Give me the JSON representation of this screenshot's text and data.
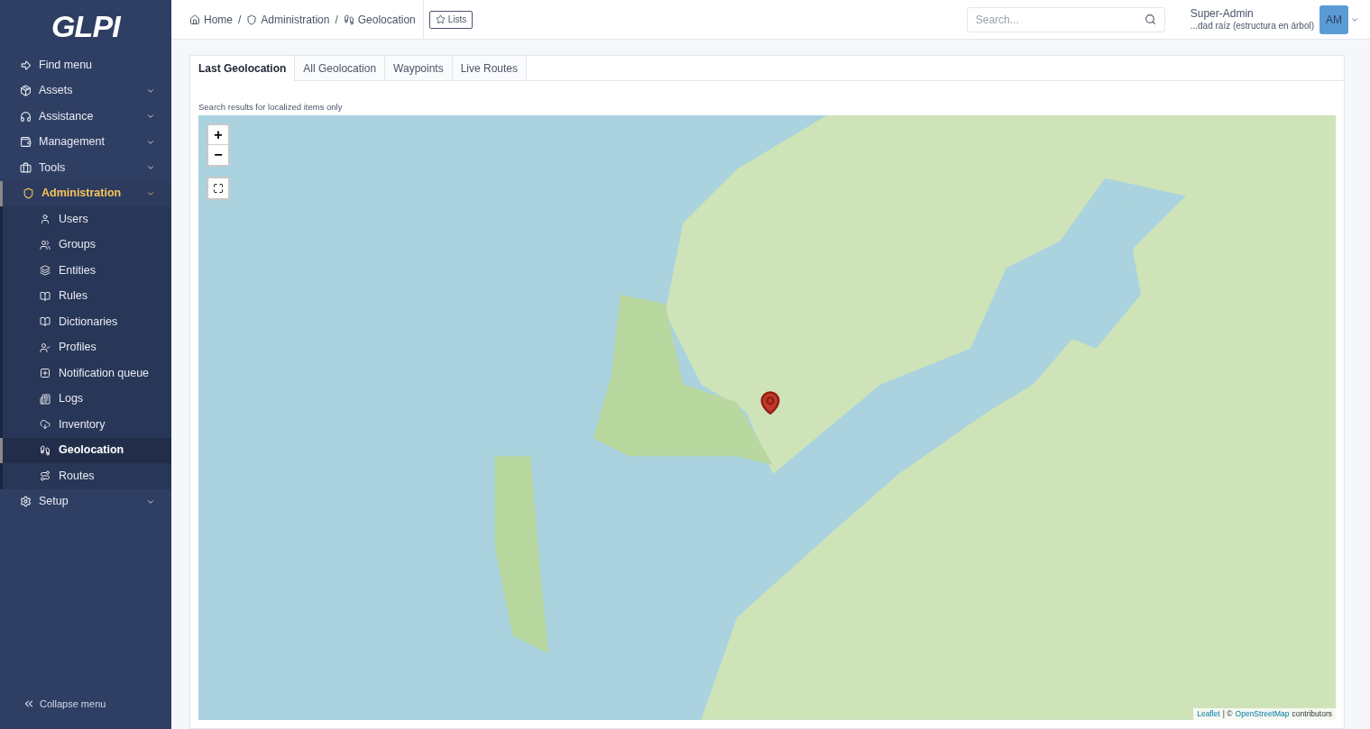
{
  "sidebar": {
    "logo": "GLPI",
    "items": [
      {
        "label": "Find menu",
        "kind": "link",
        "selected": false
      },
      {
        "label": "Assets",
        "kind": "group",
        "selected": false
      },
      {
        "label": "Assistance",
        "kind": "group",
        "selected": false
      },
      {
        "label": "Management",
        "kind": "group",
        "selected": false
      },
      {
        "label": "Tools",
        "kind": "group",
        "selected": false
      },
      {
        "label": "Administration",
        "kind": "group",
        "selected": true,
        "expanded": true,
        "children": [
          {
            "label": "Users",
            "selected": false
          },
          {
            "label": "Groups",
            "selected": false
          },
          {
            "label": "Entities",
            "selected": false
          },
          {
            "label": "Rules",
            "selected": false
          },
          {
            "label": "Dictionaries",
            "selected": false
          },
          {
            "label": "Profiles",
            "selected": false
          },
          {
            "label": "Notification queue",
            "selected": false
          },
          {
            "label": "Logs",
            "selected": false
          },
          {
            "label": "Inventory",
            "selected": false
          },
          {
            "label": "Geolocation",
            "selected": true
          },
          {
            "label": "Routes",
            "selected": false
          }
        ]
      },
      {
        "label": "Setup",
        "kind": "group",
        "selected": false
      }
    ],
    "collapse": "Collapse menu"
  },
  "breadcrumb": [
    "Home",
    "Administration",
    "Geolocation"
  ],
  "breadcrumb_separator": "/",
  "lists_button": "Lists",
  "search": {
    "placeholder": "Search..."
  },
  "user": {
    "name": "Super-Admin",
    "entity": "...dad raíz (estructura en árbol)",
    "initials": "AM"
  },
  "tabs": [
    {
      "label": "Last Geolocation",
      "selected": true
    },
    {
      "label": "All Geolocation",
      "selected": false
    },
    {
      "label": "Waypoints",
      "selected": false
    },
    {
      "label": "Live Routes",
      "selected": false
    }
  ],
  "caption": "Search results for localized items only",
  "map": {
    "zoom_in": "+",
    "zoom_out": "−",
    "attribution": {
      "leaflet": "Leaflet",
      "separator": "| ©",
      "osm": "OpenStreetMap",
      "rest": "contributors"
    }
  }
}
